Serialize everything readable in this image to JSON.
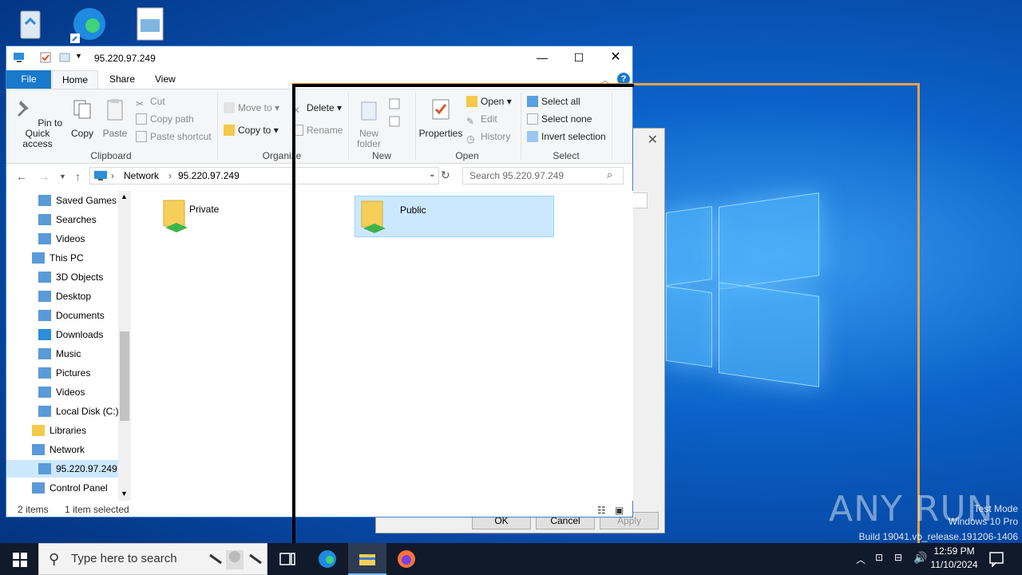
{
  "explorer": {
    "title": "95.220.97.249",
    "tabs": [
      "File",
      "Home",
      "Share",
      "View"
    ],
    "ribbon": {
      "clipboard": {
        "pin": "Pin to Quick access",
        "copy": "Copy",
        "paste": "Paste",
        "cut": "Cut",
        "copy_path": "Copy path",
        "paste_shortcut": "Paste shortcut",
        "label": "Clipboard"
      },
      "organize": {
        "move_to": "Move to",
        "copy_to": "Copy to",
        "delete": "Delete",
        "rename": "Rename",
        "label": "Organize"
      },
      "new": {
        "new_folder": "New folder",
        "label": "New"
      },
      "open": {
        "properties": "Properties",
        "open": "Open",
        "edit": "Edit",
        "history": "History",
        "label": "Open"
      },
      "select": {
        "select_all": "Select all",
        "select_none": "Select none",
        "invert": "Invert selection",
        "label": "Select"
      }
    },
    "address": {
      "crumbs": [
        "Network",
        "95.220.97.249"
      ]
    },
    "search_placeholder": "Search 95.220.97.249",
    "nav": [
      {
        "label": "Saved Games",
        "icon": "saved-games-icon"
      },
      {
        "label": "Searches",
        "icon": "search-folder-icon"
      },
      {
        "label": "Videos",
        "icon": "videos-icon"
      },
      {
        "label": "This PC",
        "icon": "this-pc-icon"
      },
      {
        "label": "3D Objects",
        "icon": "3d-objects-icon"
      },
      {
        "label": "Desktop",
        "icon": "desktop-icon"
      },
      {
        "label": "Documents",
        "icon": "documents-icon"
      },
      {
        "label": "Downloads",
        "icon": "downloads-icon"
      },
      {
        "label": "Music",
        "icon": "music-icon"
      },
      {
        "label": "Pictures",
        "icon": "pictures-icon"
      },
      {
        "label": "Videos",
        "icon": "videos-icon"
      },
      {
        "label": "Local Disk (C:)",
        "icon": "local-disk-icon"
      },
      {
        "label": "Libraries",
        "icon": "libraries-icon"
      },
      {
        "label": "Network",
        "icon": "network-icon"
      },
      {
        "label": "95.220.97.249",
        "icon": "computer-icon"
      },
      {
        "label": "Control Panel",
        "icon": "control-panel-icon"
      }
    ],
    "folders": [
      {
        "name": "Private",
        "selected": false
      },
      {
        "name": "Public",
        "selected": true
      }
    ],
    "status": {
      "count": "2 items",
      "selection": "1 item selected"
    }
  },
  "dialog": {
    "ok": "OK",
    "cancel": "Cancel",
    "apply": "Apply"
  },
  "watermark": {
    "brand": "ANY RUN",
    "mode": "Test Mode",
    "os": "Windows 10 Pro",
    "build": "Build 19041.vb_release.191206-1406"
  },
  "taskbar": {
    "search_placeholder": "Type here to search",
    "time": "12:59 PM",
    "date": "11/10/2024"
  },
  "colors": {
    "accent": "#1979ca",
    "selection": "#cce8ff",
    "frame": "#e8a34a"
  }
}
